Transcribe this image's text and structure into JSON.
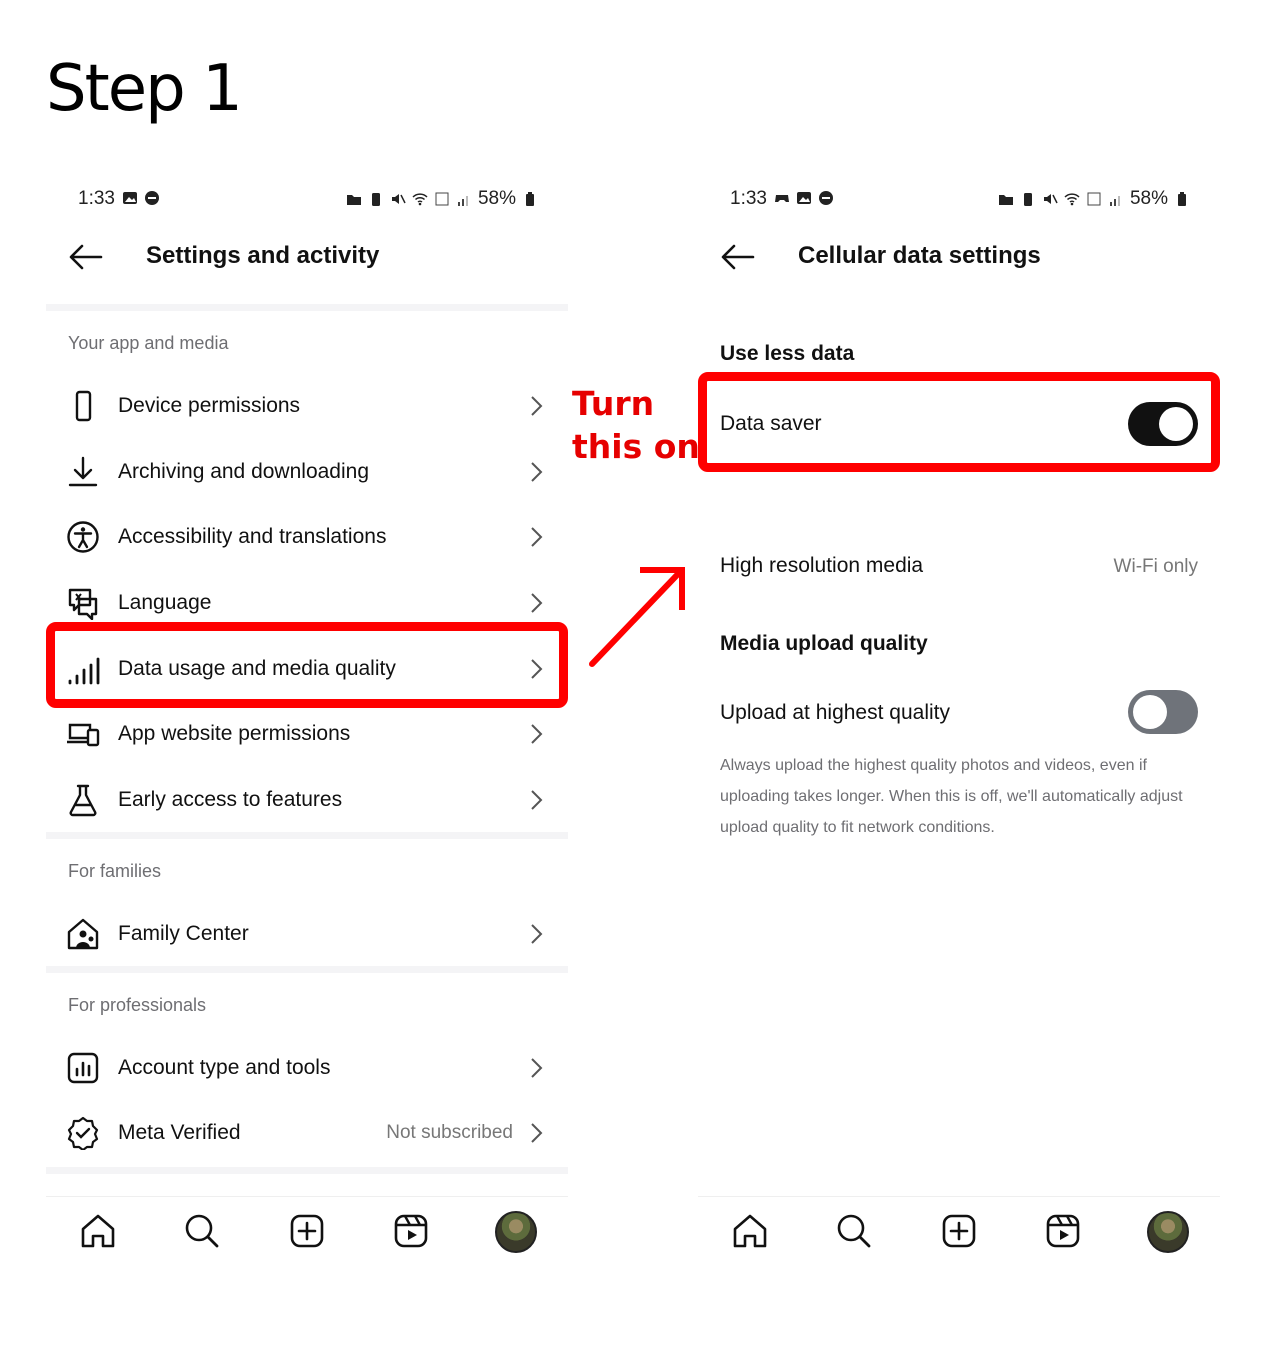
{
  "step_title": "Step 1",
  "annotation": {
    "line1": "Turn",
    "line2": "this on",
    "color": "#e60000"
  },
  "left_screen": {
    "status": {
      "time": "1:33",
      "battery": "58%"
    },
    "header": {
      "title": "Settings and activity"
    },
    "sections": [
      {
        "label": "Your app and media"
      },
      {
        "label": "For families"
      },
      {
        "label": "For professionals"
      }
    ],
    "items": [
      {
        "label": "Device permissions",
        "icon": "phone-icon"
      },
      {
        "label": "Archiving and downloading",
        "icon": "download-icon"
      },
      {
        "label": "Accessibility and translations",
        "icon": "accessibility-icon"
      },
      {
        "label": "Language",
        "icon": "language-icon"
      },
      {
        "label": "Data usage and media quality",
        "icon": "signal-bars-icon",
        "highlighted": true
      },
      {
        "label": "App website permissions",
        "icon": "devices-icon"
      },
      {
        "label": "Early access to features",
        "icon": "flask-icon"
      },
      {
        "label": "Family Center",
        "icon": "family-home-icon"
      },
      {
        "label": "Account type and tools",
        "icon": "bar-chart-icon"
      },
      {
        "label": "Meta Verified",
        "icon": "verified-badge-icon",
        "value": "Not subscribed"
      }
    ]
  },
  "right_screen": {
    "status": {
      "time": "1:33",
      "battery": "58%"
    },
    "header": {
      "title": "Cellular data settings"
    },
    "use_less_data": {
      "heading": "Use less data",
      "data_saver_label": "Data saver",
      "data_saver_on": true
    },
    "high_res": {
      "label": "High resolution media",
      "value": "Wi-Fi only"
    },
    "upload": {
      "heading": "Media upload quality",
      "label": "Upload at highest quality",
      "on": false,
      "description": "Always upload the highest quality photos and videos, even if uploading takes longer. When this is off, we'll automatically adjust upload quality to fit network conditions."
    }
  },
  "nav": [
    "home-icon",
    "search-icon",
    "create-icon",
    "reels-icon",
    "profile-avatar"
  ]
}
